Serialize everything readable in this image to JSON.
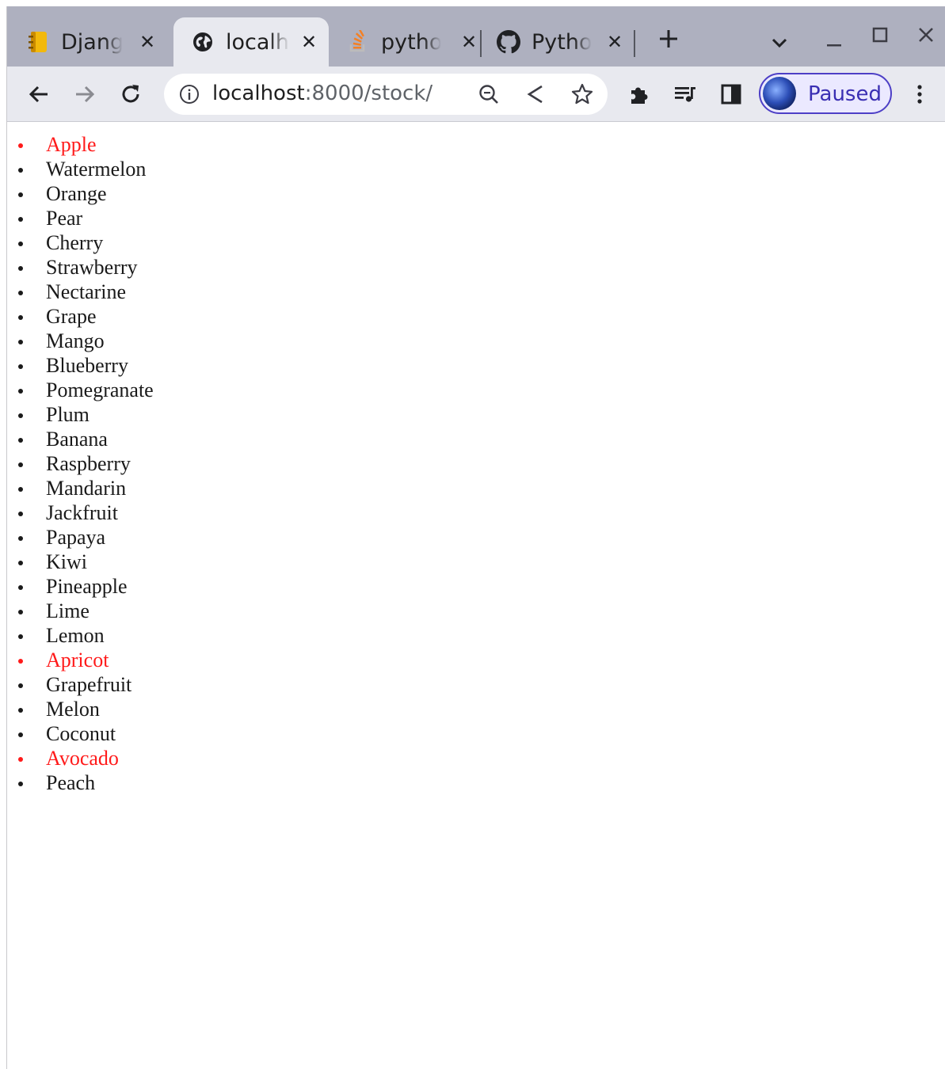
{
  "tabs": [
    {
      "title": "Djang",
      "icon": "notebook-icon",
      "active": false
    },
    {
      "title": "localh",
      "icon": "globe-icon",
      "active": true
    },
    {
      "title": "pytho",
      "icon": "stackoverflow-icon",
      "active": false
    },
    {
      "title": "Pytho",
      "icon": "github-icon",
      "active": false
    }
  ],
  "toolbar": {
    "url_host": "localhost",
    "url_rest": ":8000/stock/",
    "profile_label": "Paused"
  },
  "colors": {
    "highlight": "#ff1a1a",
    "text": "#1a1a1a",
    "tabstrip": "#aeb0bf",
    "toolbar": "#e8e9ef",
    "profile_accent": "#4d3fc6"
  },
  "fruits": [
    {
      "name": "Apple",
      "highlighted": true
    },
    {
      "name": "Watermelon",
      "highlighted": false
    },
    {
      "name": "Orange",
      "highlighted": false
    },
    {
      "name": "Pear",
      "highlighted": false
    },
    {
      "name": "Cherry",
      "highlighted": false
    },
    {
      "name": "Strawberry",
      "highlighted": false
    },
    {
      "name": "Nectarine",
      "highlighted": false
    },
    {
      "name": "Grape",
      "highlighted": false
    },
    {
      "name": "Mango",
      "highlighted": false
    },
    {
      "name": "Blueberry",
      "highlighted": false
    },
    {
      "name": "Pomegranate",
      "highlighted": false
    },
    {
      "name": "Plum",
      "highlighted": false
    },
    {
      "name": "Banana",
      "highlighted": false
    },
    {
      "name": "Raspberry",
      "highlighted": false
    },
    {
      "name": "Mandarin",
      "highlighted": false
    },
    {
      "name": "Jackfruit",
      "highlighted": false
    },
    {
      "name": "Papaya",
      "highlighted": false
    },
    {
      "name": "Kiwi",
      "highlighted": false
    },
    {
      "name": "Pineapple",
      "highlighted": false
    },
    {
      "name": "Lime",
      "highlighted": false
    },
    {
      "name": "Lemon",
      "highlighted": false
    },
    {
      "name": "Apricot",
      "highlighted": true
    },
    {
      "name": "Grapefruit",
      "highlighted": false
    },
    {
      "name": "Melon",
      "highlighted": false
    },
    {
      "name": "Coconut",
      "highlighted": false
    },
    {
      "name": "Avocado",
      "highlighted": true
    },
    {
      "name": "Peach",
      "highlighted": false
    }
  ]
}
